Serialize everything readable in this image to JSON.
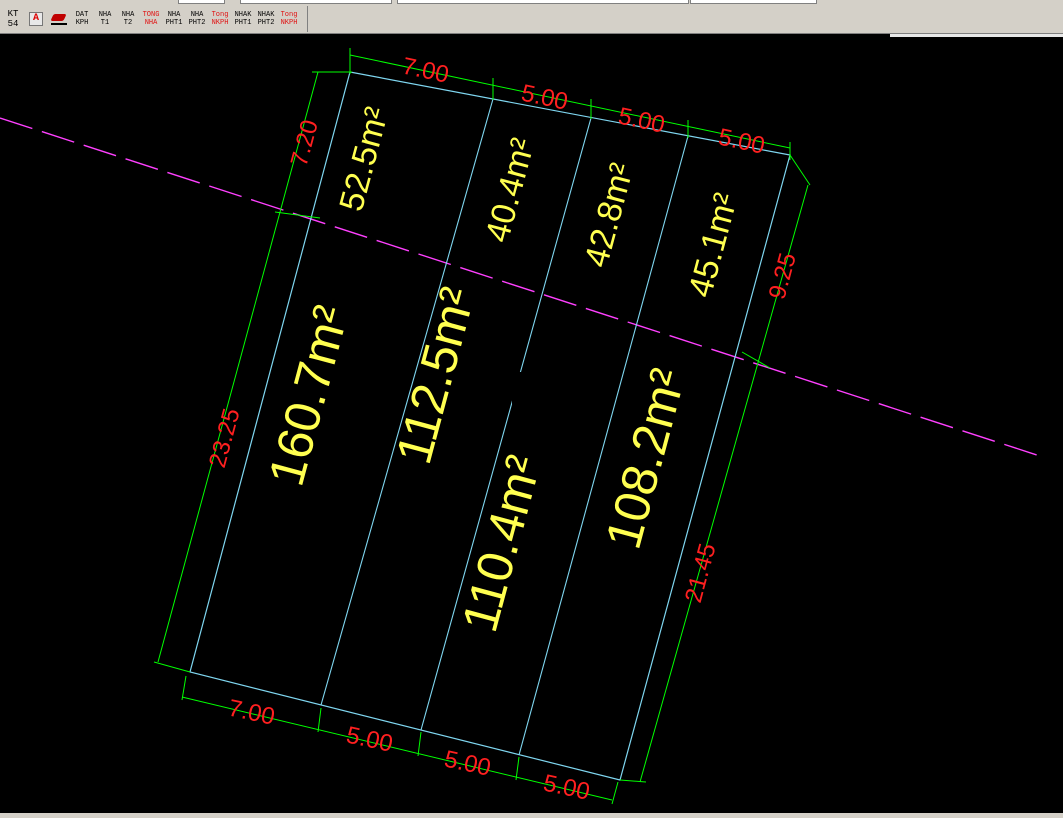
{
  "toolbar": {
    "buttons": [
      {
        "line1": "KT",
        "line2": "54",
        "color": "#000000"
      },
      {
        "line1": "DAT",
        "line2": "KPH",
        "color": "#000000"
      },
      {
        "line1": "NHA",
        "line2": "T1",
        "color": "#000000"
      },
      {
        "line1": "NHA",
        "line2": "T2",
        "color": "#000000"
      },
      {
        "line1": "TONG",
        "line2": "NHA",
        "color": "#e01010"
      },
      {
        "line1": "NHA",
        "line2": "PHT1",
        "color": "#000000"
      },
      {
        "line1": "NHA",
        "line2": "PHT2",
        "color": "#000000"
      },
      {
        "line1": "Tong",
        "line2": "NKPH",
        "color": "#e01010"
      },
      {
        "line1": "NHAK",
        "line2": "PHT1",
        "color": "#000000"
      },
      {
        "line1": "NHAK",
        "line2": "PHT2",
        "color": "#000000"
      },
      {
        "line1": "Tong",
        "line2": "NKPH",
        "color": "#e01010"
      }
    ]
  },
  "drawing": {
    "colors": {
      "background": "#000000",
      "parcel_outline": "#7fd6f0",
      "dimension_line": "#00ff00",
      "dimension_text": "#ff2020",
      "area_text": "#ffff50",
      "setback_line": "#ff40ff"
    },
    "dimensions": {
      "top": [
        "7.00",
        "5.00",
        "5.00",
        "5.00"
      ],
      "bottom": [
        "7.00",
        "5.00",
        "5.00",
        "5.00"
      ],
      "left_top": "7.20",
      "left_bottom": "23.25",
      "right_top": "9.25",
      "right_bottom": "21.45"
    },
    "areas_front": [
      "52.5m²",
      "40.4m²",
      "42.8m²",
      "45.1m²"
    ],
    "areas_back": [
      "160.7m²",
      "112.5m²",
      "110.4m²",
      "108.2m²"
    ]
  }
}
